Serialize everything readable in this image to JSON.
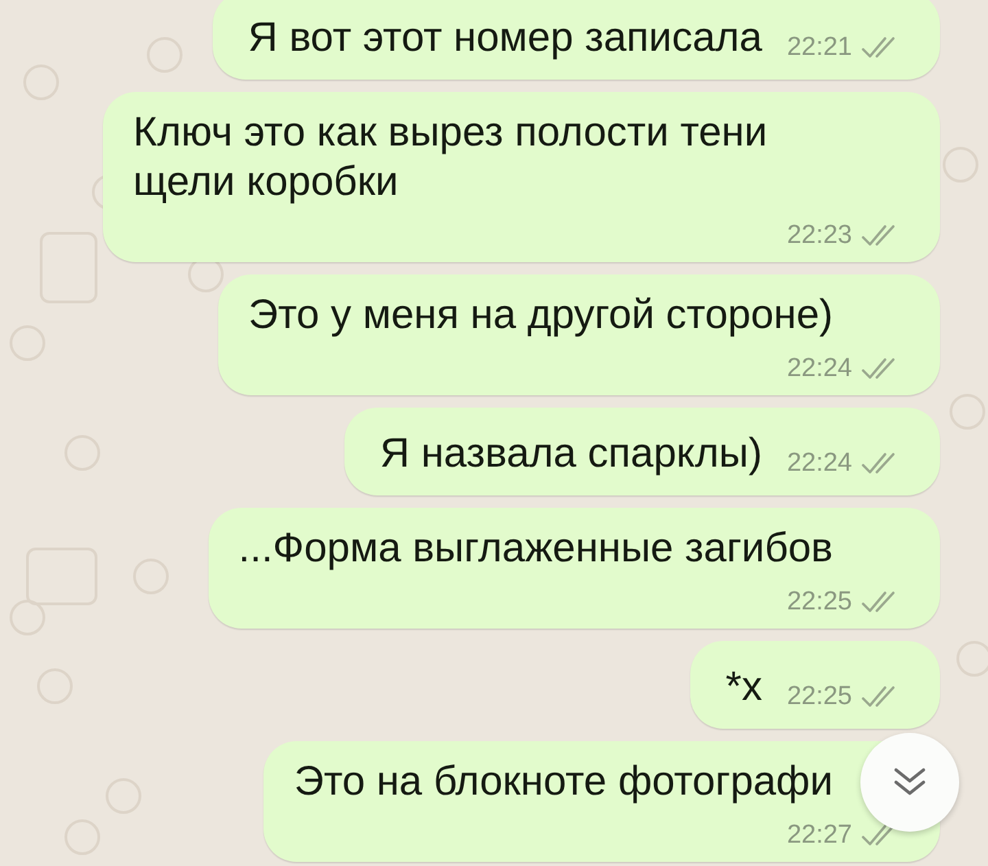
{
  "messages": [
    {
      "text": "Я вот этот номер записала",
      "time": "22:21",
      "kind": "inline"
    },
    {
      "text": "Ключ это как вырез полости тени щели коробки",
      "time": "22:23",
      "kind": "stacked"
    },
    {
      "text": "Это у меня на другой стороне)",
      "time": "22:24",
      "kind": "stacked"
    },
    {
      "text": "Я назвала спарклы)",
      "time": "22:24",
      "kind": "inline"
    },
    {
      "text": "...Форма выглаженные загибов",
      "time": "22:25",
      "kind": "stacked"
    },
    {
      "text": "*х",
      "time": "22:25",
      "kind": "inline"
    },
    {
      "text": "Это на блокноте фотографи",
      "time": "22:27",
      "kind": "stacked"
    }
  ]
}
